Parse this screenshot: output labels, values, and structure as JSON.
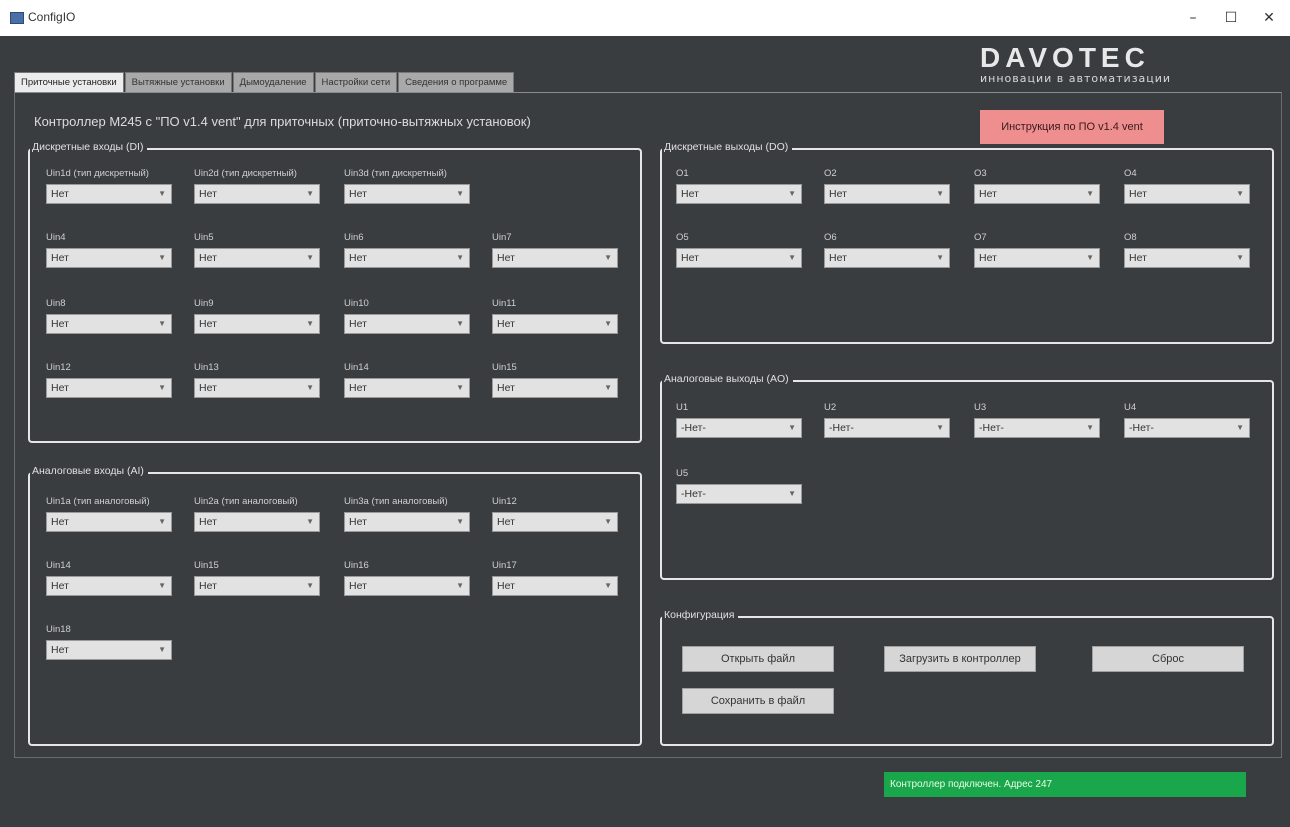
{
  "window": {
    "title": "ConfigIO",
    "minimize": "–",
    "maximize": "☐",
    "close": "✕"
  },
  "logo": {
    "brand": "DAVOTEC",
    "tagline": "инновации в автоматизации"
  },
  "tabs": [
    {
      "label": "Приточные установки"
    },
    {
      "label": "Вытяжные установки"
    },
    {
      "label": "Дымоудаление"
    },
    {
      "label": "Настройки сети"
    },
    {
      "label": "Сведения о программе"
    }
  ],
  "page": {
    "title": "Контроллер М245 с \"ПО v1.4 vent\" для приточных (приточно-вытяжных установок)",
    "instruction_button": "Инструкция по ПО v1.4 vent"
  },
  "groups": {
    "di": "Дискретные входы (DI)",
    "ai": "Аналоговые входы (AI)",
    "do": "Дискретные выходы (DO)",
    "ao": "Аналоговые выходы (AO)",
    "cfg": "Конфигурация"
  },
  "di_fields": [
    {
      "label": "Uin1d (тип дискретный)",
      "value": "Нет"
    },
    {
      "label": "Uin2d (тип дискретный)",
      "value": "Нет"
    },
    {
      "label": "Uin3d (тип дискретный)",
      "value": "Нет"
    },
    {
      "label": "Uin4",
      "value": "Нет"
    },
    {
      "label": "Uin5",
      "value": "Нет"
    },
    {
      "label": "Uin6",
      "value": "Нет"
    },
    {
      "label": "Uin7",
      "value": "Нет"
    },
    {
      "label": "Uin8",
      "value": "Нет"
    },
    {
      "label": "Uin9",
      "value": "Нет"
    },
    {
      "label": "Uin10",
      "value": "Нет"
    },
    {
      "label": "Uin11",
      "value": "Нет"
    },
    {
      "label": "Uin12",
      "value": "Нет"
    },
    {
      "label": "Uin13",
      "value": "Нет"
    },
    {
      "label": "Uin14",
      "value": "Нет"
    },
    {
      "label": "Uin15",
      "value": "Нет"
    }
  ],
  "ai_fields": [
    {
      "label": "Uin1a (тип аналоговый)",
      "value": "Нет"
    },
    {
      "label": "Uin2a (тип аналоговый)",
      "value": "Нет"
    },
    {
      "label": "Uin3a (тип аналоговый)",
      "value": "Нет"
    },
    {
      "label": "Uin12",
      "value": "Нет"
    },
    {
      "label": "Uin14",
      "value": "Нет"
    },
    {
      "label": "Uin15",
      "value": "Нет"
    },
    {
      "label": "Uin16",
      "value": "Нет"
    },
    {
      "label": "Uin17",
      "value": "Нет"
    },
    {
      "label": "Uin18",
      "value": "Нет"
    }
  ],
  "do_fields": [
    {
      "label": "O1",
      "value": "Нет"
    },
    {
      "label": "O2",
      "value": "Нет"
    },
    {
      "label": "O3",
      "value": "Нет"
    },
    {
      "label": "O4",
      "value": "Нет"
    },
    {
      "label": "O5",
      "value": "Нет"
    },
    {
      "label": "O6",
      "value": "Нет"
    },
    {
      "label": "O7",
      "value": "Нет"
    },
    {
      "label": "O8",
      "value": "Нет"
    }
  ],
  "ao_fields": [
    {
      "label": "U1",
      "value": "-Нет-"
    },
    {
      "label": "U2",
      "value": "-Нет-"
    },
    {
      "label": "U3",
      "value": "-Нет-"
    },
    {
      "label": "U4",
      "value": "-Нет-"
    },
    {
      "label": "U5",
      "value": "-Нет-"
    }
  ],
  "config": {
    "open_file": "Открыть файл",
    "upload": "Загрузить в контроллер",
    "reset": "Сброс",
    "save_file": "Сохранить в файл"
  },
  "status": {
    "text": "Контроллер подключен. Адрес 247",
    "color": "#1aa64a"
  }
}
